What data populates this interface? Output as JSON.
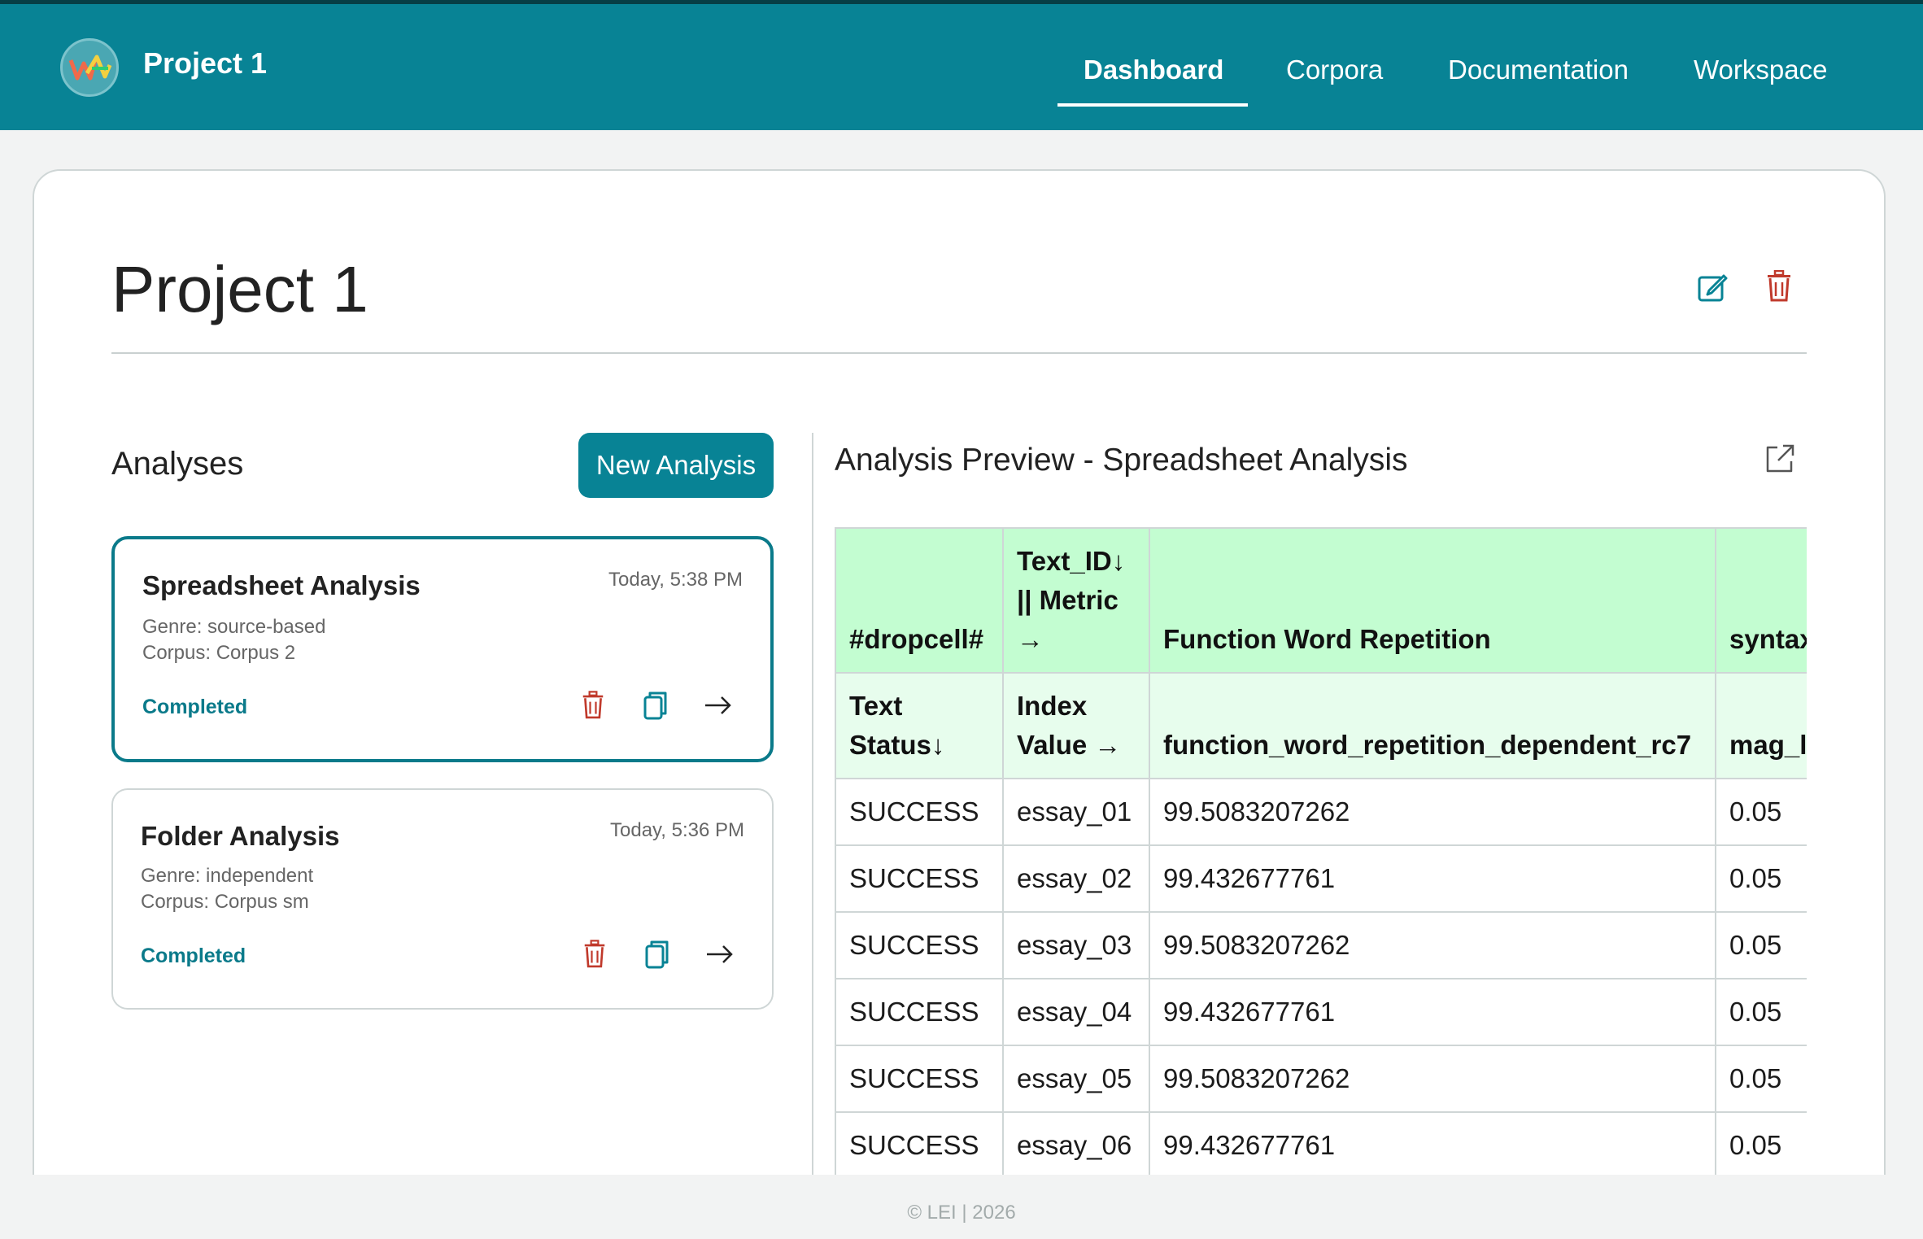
{
  "nav": {
    "brand": "Project 1",
    "items": [
      {
        "label": "Dashboard",
        "active": true
      },
      {
        "label": "Corpora",
        "active": false
      },
      {
        "label": "Documentation",
        "active": false
      },
      {
        "label": "Workspace",
        "active": false
      }
    ]
  },
  "page": {
    "title": "Project 1"
  },
  "analyses": {
    "heading": "Analyses",
    "new_button": "New Analysis",
    "items": [
      {
        "title": "Spreadsheet Analysis",
        "time": "Today, 5:38 PM",
        "genre": "Genre: source-based",
        "corpus": "Corpus: Corpus 2",
        "status": "Completed",
        "selected": true
      },
      {
        "title": "Folder Analysis",
        "time": "Today, 5:36 PM",
        "genre": "Genre: independent",
        "corpus": "Corpus: Corpus sm",
        "status": "Completed",
        "selected": false
      }
    ]
  },
  "preview": {
    "title": "Analysis Preview - Spreadsheet Analysis",
    "header_row_1": [
      "#dropcell#",
      "Text_ID↓ || Metric →",
      "Function Word Repetition",
      "syntax"
    ],
    "header_row_2": [
      "Text Status↓",
      "Index Value →",
      "function_word_repetition_dependent_rc7",
      "mag_l"
    ],
    "rows": [
      [
        "SUCCESS",
        "essay_01",
        "99.5083207262",
        "0.05"
      ],
      [
        "SUCCESS",
        "essay_02",
        "99.432677761",
        "0.05"
      ],
      [
        "SUCCESS",
        "essay_03",
        "99.5083207262",
        "0.05"
      ],
      [
        "SUCCESS",
        "essay_04",
        "99.432677761",
        "0.05"
      ],
      [
        "SUCCESS",
        "essay_05",
        "99.5083207262",
        "0.05"
      ],
      [
        "SUCCESS",
        "essay_06",
        "99.432677761",
        "0.05"
      ]
    ]
  },
  "footer": {
    "copyright": "© LEI | 2026"
  },
  "colors": {
    "primary": "#088395",
    "danger": "#c0392b",
    "header_green": "#c3fdd1",
    "subheader_green": "#e7fded"
  },
  "icons": [
    "logo-icon",
    "edit-icon",
    "trash-icon",
    "copy-icon",
    "arrow-right-icon",
    "external-link-icon"
  ]
}
